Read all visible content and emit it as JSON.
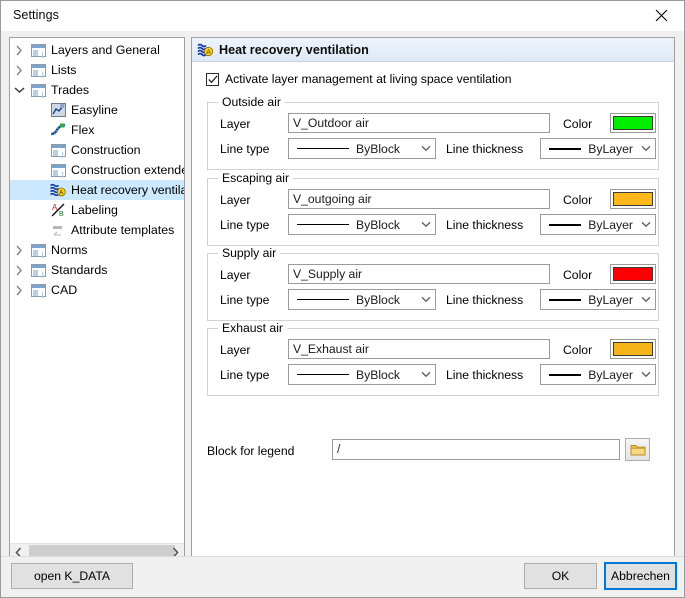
{
  "window": {
    "title": "Settings",
    "close_icon": "close-icon"
  },
  "tree": {
    "items": [
      {
        "label": "Layers and General",
        "icon": "document-icon",
        "expander": "collapsed",
        "depth": 0,
        "selected": false
      },
      {
        "label": "Lists",
        "icon": "document-icon",
        "expander": "collapsed",
        "depth": 0,
        "selected": false
      },
      {
        "label": "Trades",
        "icon": "document-icon",
        "expander": "expanded",
        "depth": 0,
        "selected": false
      },
      {
        "label": "Easyline",
        "icon": "easyline-icon",
        "expander": "none",
        "depth": 1,
        "selected": false
      },
      {
        "label": "Flex",
        "icon": "flex-icon",
        "expander": "none",
        "depth": 1,
        "selected": false
      },
      {
        "label": "Construction",
        "icon": "document-icon",
        "expander": "none",
        "depth": 1,
        "selected": false
      },
      {
        "label": "Construction extended",
        "icon": "document-icon",
        "expander": "none",
        "depth": 1,
        "selected": false
      },
      {
        "label": "Heat recovery ventilation",
        "icon": "ventilation-icon",
        "expander": "none",
        "depth": 1,
        "selected": true
      },
      {
        "label": "Labeling",
        "icon": "labeling-icon",
        "expander": "none",
        "depth": 1,
        "selected": false
      },
      {
        "label": "Attribute templates",
        "icon": "attribute-template-icon",
        "expander": "none",
        "depth": 1,
        "selected": false
      },
      {
        "label": "Norms",
        "icon": "document-icon",
        "expander": "collapsed",
        "depth": 0,
        "selected": false
      },
      {
        "label": "Standards",
        "icon": "document-icon",
        "expander": "collapsed",
        "depth": 0,
        "selected": false
      },
      {
        "label": "CAD",
        "icon": "document-icon",
        "expander": "collapsed",
        "depth": 0,
        "selected": false
      }
    ],
    "scrollbar": {
      "left_arrow": "chevron-left-icon",
      "right_arrow": "chevron-right-icon"
    }
  },
  "panel": {
    "header_title": "Heat recovery ventilation",
    "header_icon": "ventilation-icon",
    "checkbox": {
      "label": "Activate layer management at living space ventilation",
      "checked": true
    },
    "groups": [
      {
        "title": "Outside air",
        "layer_label": "Layer",
        "layer_value": "V_Outdoor air",
        "color_label": "Color",
        "color_value": "#00EE00",
        "linetype_label": "Line type",
        "linetype_value": "ByBlock",
        "thickness_label": "Line thickness",
        "thickness_value": "ByLayer"
      },
      {
        "title": "Escaping air",
        "layer_label": "Layer",
        "layer_value": "V_outgoing air",
        "color_label": "Color",
        "color_value": "#FFB71A",
        "linetype_label": "Line type",
        "linetype_value": "ByBlock",
        "thickness_label": "Line thickness",
        "thickness_value": "ByLayer"
      },
      {
        "title": "Supply air",
        "layer_label": "Layer",
        "layer_value": "V_Supply air",
        "color_label": "Color",
        "color_value": "#FA0000",
        "linetype_label": "Line type",
        "linetype_value": "ByBlock",
        "thickness_label": "Line thickness",
        "thickness_value": "ByLayer"
      },
      {
        "title": "Exhaust air",
        "layer_label": "Layer",
        "layer_value": "V_Exhaust air",
        "color_label": "Color",
        "color_value": "#F5B41A",
        "linetype_label": "Line type",
        "linetype_value": "ByBlock",
        "thickness_label": "Line thickness",
        "thickness_value": "ByLayer"
      }
    ],
    "legend": {
      "label": "Block for legend",
      "value": "/",
      "browse_icon": "folder-icon"
    }
  },
  "footer": {
    "open_data_label": "open K_DATA",
    "ok_label": "OK",
    "cancel_label": "Abbrechen"
  }
}
